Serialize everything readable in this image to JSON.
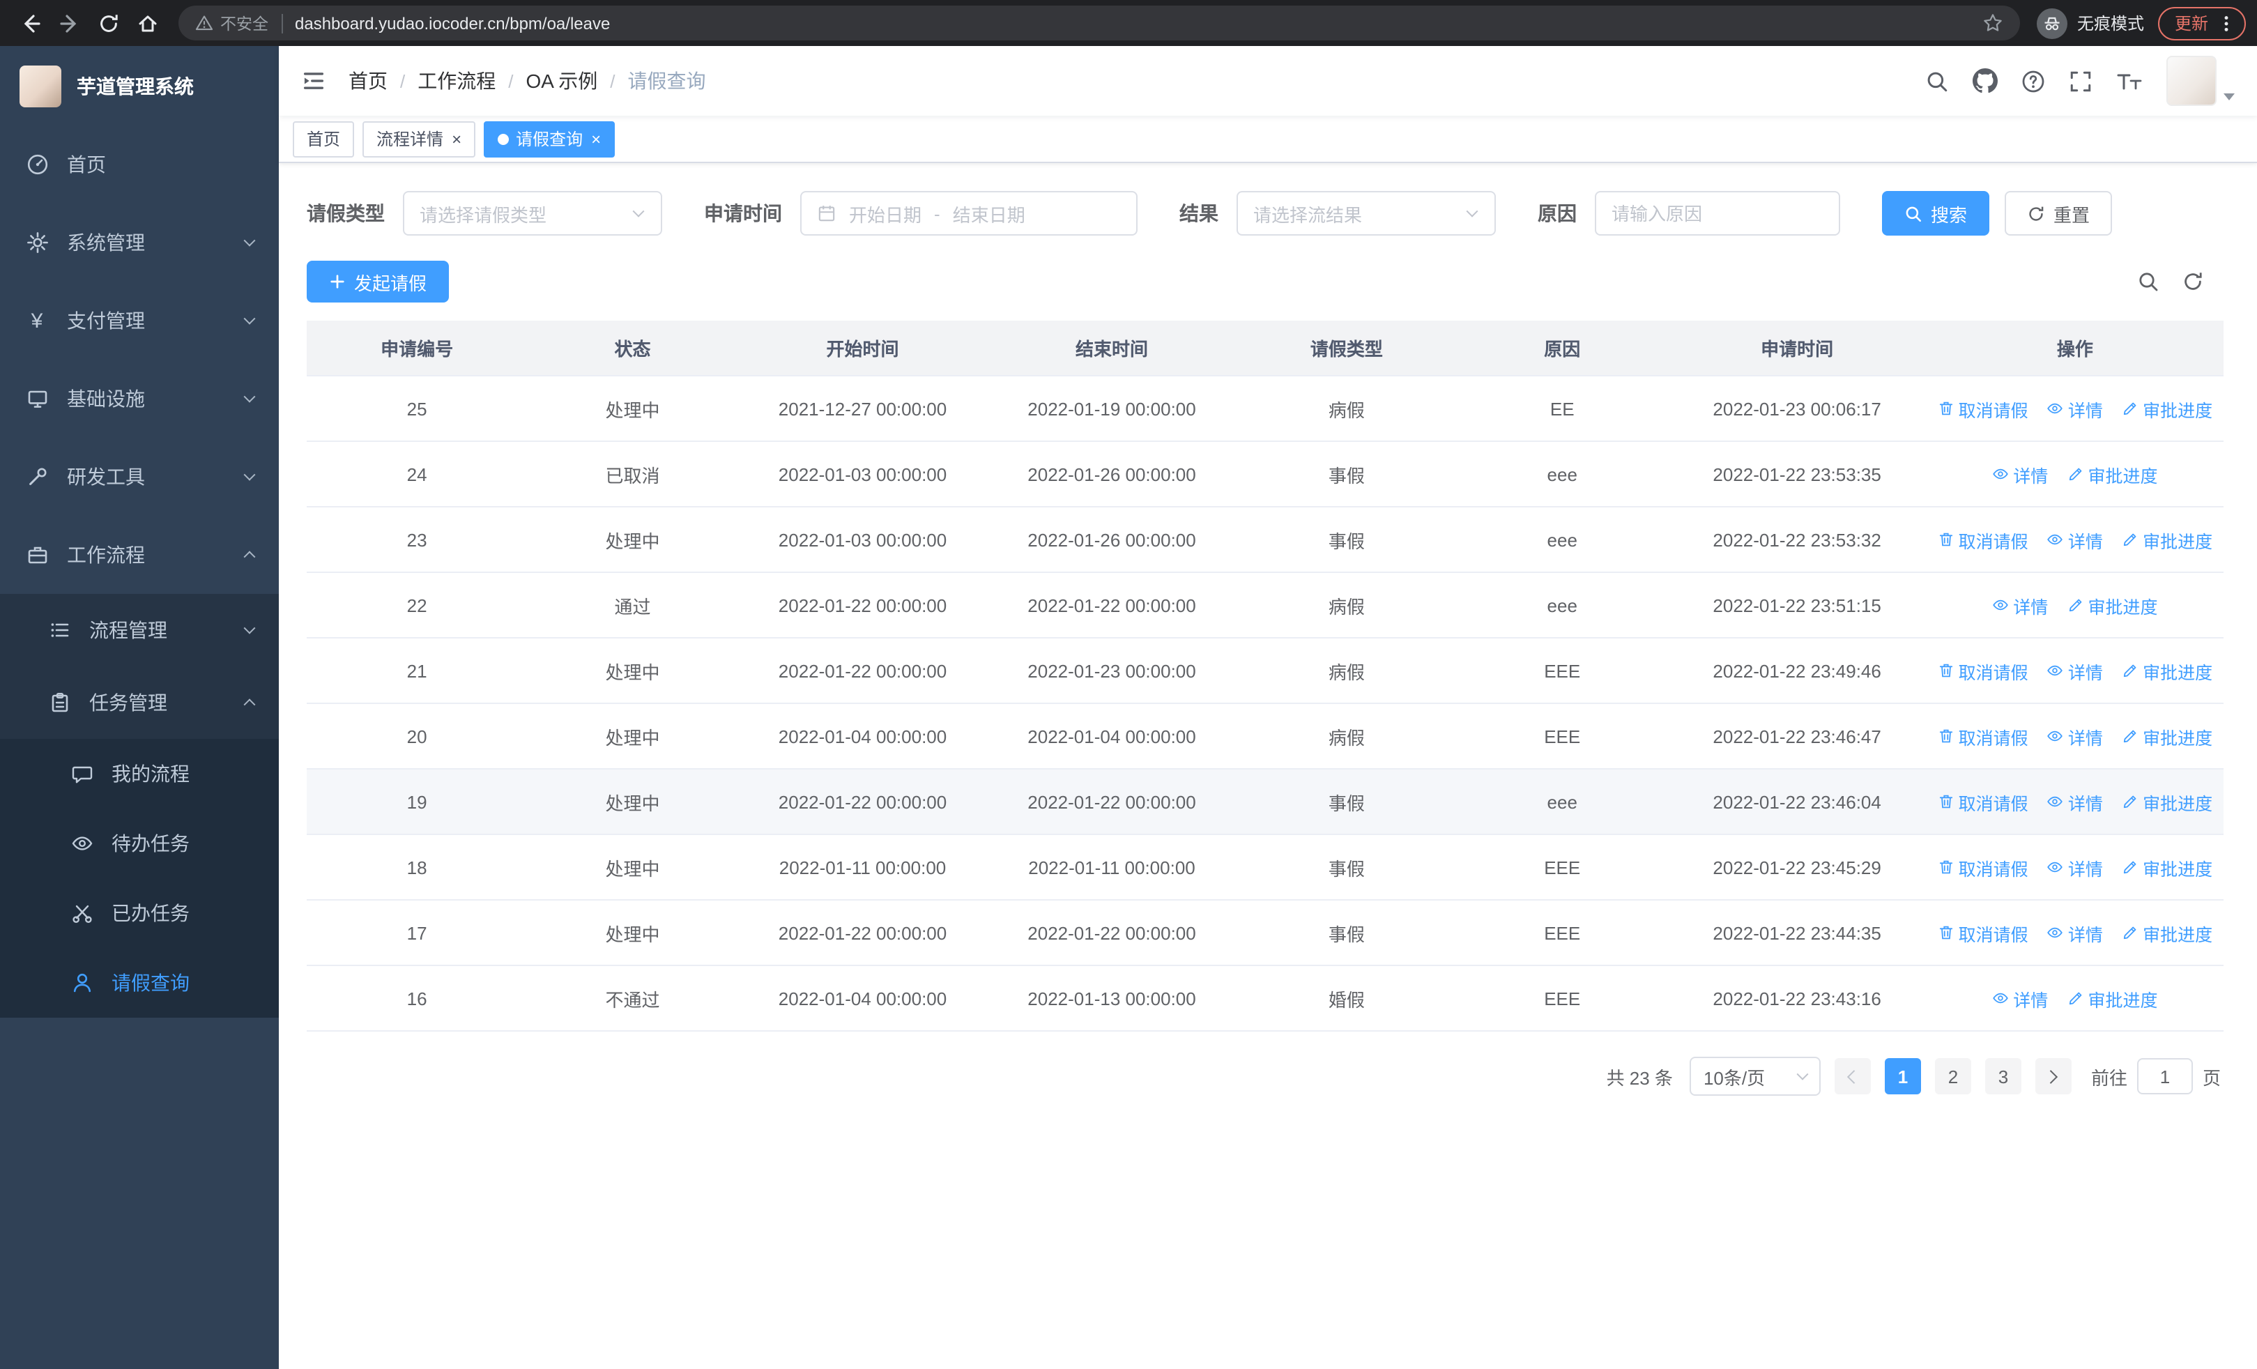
{
  "browser": {
    "security_label": "不安全",
    "url": "dashboard.yudao.iocoder.cn/bpm/oa/leave",
    "incognito_label": "无痕模式",
    "update_label": "更新"
  },
  "accent_color": "#409EFF",
  "sidebar": {
    "logo_title": "芋道管理系统",
    "items": [
      {
        "label": "首页"
      },
      {
        "label": "系统管理"
      },
      {
        "label": "支付管理"
      },
      {
        "label": "基础设施"
      },
      {
        "label": "研发工具"
      },
      {
        "label": "工作流程"
      }
    ],
    "sub_items": [
      {
        "label": "流程管理"
      },
      {
        "label": "任务管理"
      }
    ],
    "leaf_items": [
      {
        "label": "我的流程"
      },
      {
        "label": "待办任务"
      },
      {
        "label": "已办任务"
      },
      {
        "label": "请假查询",
        "active": true
      }
    ]
  },
  "header": {
    "breadcrumb": [
      "首页",
      "工作流程",
      "OA 示例",
      "请假查询"
    ]
  },
  "tabs": [
    {
      "label": "首页"
    },
    {
      "label": "流程详情"
    },
    {
      "label": "请假查询",
      "active": true
    }
  ],
  "filters": {
    "leave_type_label": "请假类型",
    "leave_type_placeholder": "请选择请假类型",
    "apply_time_label": "申请时间",
    "start_date_placeholder": "开始日期",
    "range_separator": "-",
    "end_date_placeholder": "结束日期",
    "result_label": "结果",
    "result_placeholder": "请选择流结果",
    "reason_label": "原因",
    "reason_placeholder": "请输入原因",
    "search_button": "搜索",
    "reset_button": "重置"
  },
  "toolbar": {
    "create_button": "发起请假"
  },
  "table": {
    "columns": [
      "申请编号",
      "状态",
      "开始时间",
      "结束时间",
      "请假类型",
      "原因",
      "申请时间",
      "操作"
    ],
    "action_labels": {
      "cancel": "取消请假",
      "detail": "详情",
      "progress": "审批进度"
    },
    "rows": [
      {
        "id": "25",
        "status": "处理中",
        "start": "2021-12-27 00:00:00",
        "end": "2022-01-19 00:00:00",
        "type": "病假",
        "reason": "EE",
        "apply_time": "2022-01-23 00:06:17",
        "cancellable": true
      },
      {
        "id": "24",
        "status": "已取消",
        "start": "2022-01-03 00:00:00",
        "end": "2022-01-26 00:00:00",
        "type": "事假",
        "reason": "eee",
        "apply_time": "2022-01-22 23:53:35",
        "cancellable": false
      },
      {
        "id": "23",
        "status": "处理中",
        "start": "2022-01-03 00:00:00",
        "end": "2022-01-26 00:00:00",
        "type": "事假",
        "reason": "eee",
        "apply_time": "2022-01-22 23:53:32",
        "cancellable": true
      },
      {
        "id": "22",
        "status": "通过",
        "start": "2022-01-22 00:00:00",
        "end": "2022-01-22 00:00:00",
        "type": "病假",
        "reason": "eee",
        "apply_time": "2022-01-22 23:51:15",
        "cancellable": false
      },
      {
        "id": "21",
        "status": "处理中",
        "start": "2022-01-22 00:00:00",
        "end": "2022-01-23 00:00:00",
        "type": "病假",
        "reason": "EEE",
        "apply_time": "2022-01-22 23:49:46",
        "cancellable": true
      },
      {
        "id": "20",
        "status": "处理中",
        "start": "2022-01-04 00:00:00",
        "end": "2022-01-04 00:00:00",
        "type": "病假",
        "reason": "EEE",
        "apply_time": "2022-01-22 23:46:47",
        "cancellable": true
      },
      {
        "id": "19",
        "status": "处理中",
        "start": "2022-01-22 00:00:00",
        "end": "2022-01-22 00:00:00",
        "type": "事假",
        "reason": "eee",
        "apply_time": "2022-01-22 23:46:04",
        "cancellable": true,
        "highlighted": true
      },
      {
        "id": "18",
        "status": "处理中",
        "start": "2022-01-11 00:00:00",
        "end": "2022-01-11 00:00:00",
        "type": "事假",
        "reason": "EEE",
        "apply_time": "2022-01-22 23:45:29",
        "cancellable": true
      },
      {
        "id": "17",
        "status": "处理中",
        "start": "2022-01-22 00:00:00",
        "end": "2022-01-22 00:00:00",
        "type": "事假",
        "reason": "EEE",
        "apply_time": "2022-01-22 23:44:35",
        "cancellable": true
      },
      {
        "id": "16",
        "status": "不通过",
        "start": "2022-01-04 00:00:00",
        "end": "2022-01-13 00:00:00",
        "type": "婚假",
        "reason": "EEE",
        "apply_time": "2022-01-22 23:43:16",
        "cancellable": false
      }
    ]
  },
  "pagination": {
    "total": "共 23 条",
    "page_size": "10条/页",
    "pages": [
      "1",
      "2",
      "3"
    ],
    "goto_label": "前往",
    "goto_value": "1",
    "page_unit": "页"
  }
}
